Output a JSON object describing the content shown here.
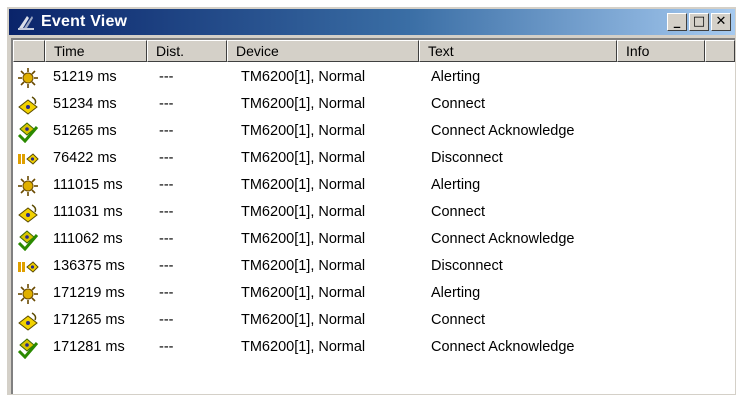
{
  "window": {
    "title": "Event View",
    "buttons": {
      "minimize": "_",
      "maximize": "□",
      "close": "✕"
    }
  },
  "columns": [
    "Time",
    "Dist.",
    "Device",
    "Text",
    "Info"
  ],
  "rows": [
    {
      "icon": "alerting-icon",
      "time": "51219 ms",
      "dist": "---",
      "device": "TM6200[1], Normal",
      "text": "Alerting",
      "info": ""
    },
    {
      "icon": "connect-icon",
      "time": "51234 ms",
      "dist": "---",
      "device": "TM6200[1], Normal",
      "text": "Connect",
      "info": ""
    },
    {
      "icon": "connect-acknowledge-icon",
      "time": "51265 ms",
      "dist": "---",
      "device": "TM6200[1], Normal",
      "text": "Connect Acknowledge",
      "info": ""
    },
    {
      "icon": "disconnect-icon",
      "time": "76422 ms",
      "dist": "---",
      "device": "TM6200[1], Normal",
      "text": "Disconnect",
      "info": ""
    },
    {
      "icon": "alerting-icon",
      "time": "111015 ms",
      "dist": "---",
      "device": "TM6200[1], Normal",
      "text": "Alerting",
      "info": ""
    },
    {
      "icon": "connect-icon",
      "time": "111031 ms",
      "dist": "---",
      "device": "TM6200[1], Normal",
      "text": "Connect",
      "info": ""
    },
    {
      "icon": "connect-acknowledge-icon",
      "time": "111062 ms",
      "dist": "---",
      "device": "TM6200[1], Normal",
      "text": "Connect Acknowledge",
      "info": ""
    },
    {
      "icon": "disconnect-icon",
      "time": "136375 ms",
      "dist": "---",
      "device": "TM6200[1], Normal",
      "text": "Disconnect",
      "info": ""
    },
    {
      "icon": "alerting-icon",
      "time": "171219 ms",
      "dist": "---",
      "device": "TM6200[1], Normal",
      "text": "Alerting",
      "info": ""
    },
    {
      "icon": "connect-icon",
      "time": "171265 ms",
      "dist": "---",
      "device": "TM6200[1], Normal",
      "text": "Connect",
      "info": ""
    },
    {
      "icon": "connect-acknowledge-icon",
      "time": "171281 ms",
      "dist": "---",
      "device": "TM6200[1], Normal",
      "text": "Connect Acknowledge",
      "info": ""
    }
  ],
  "colors": {
    "titlebar_start": "#0a246a",
    "titlebar_end": "#a6caf0",
    "face": "#d4d0c8"
  }
}
